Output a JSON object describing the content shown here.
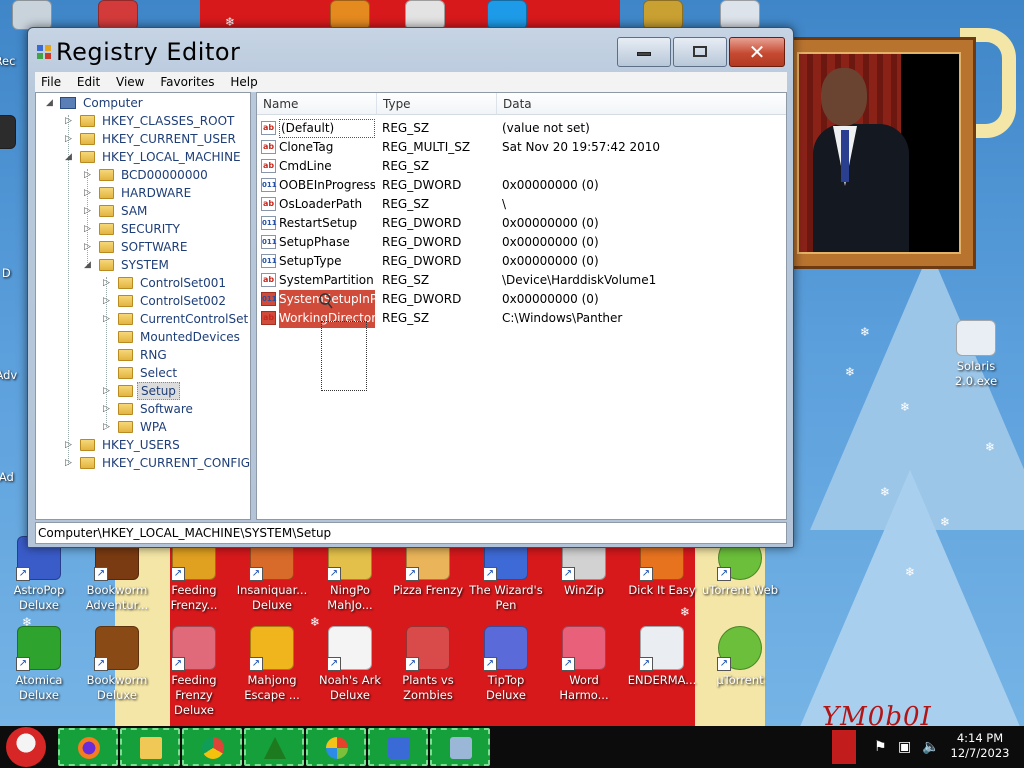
{
  "window": {
    "title": "Registry Editor",
    "menu": [
      "File",
      "Edit",
      "View",
      "Favorites",
      "Help"
    ],
    "status_path": "Computer\\HKEY_LOCAL_MACHINE\\SYSTEM\\Setup"
  },
  "tree": {
    "root": "Computer",
    "hives": [
      "HKEY_CLASSES_ROOT",
      "HKEY_CURRENT_USER",
      "HKEY_LOCAL_MACHINE",
      "HKEY_USERS",
      "HKEY_CURRENT_CONFIG"
    ],
    "hklm_children": [
      "BCD00000000",
      "HARDWARE",
      "SAM",
      "SECURITY",
      "SOFTWARE",
      "SYSTEM"
    ],
    "system_children": [
      "ControlSet001",
      "ControlSet002",
      "CurrentControlSet",
      "MountedDevices",
      "RNG",
      "Select",
      "Setup",
      "Software",
      "WPA"
    ],
    "selected": "Setup"
  },
  "list": {
    "columns": [
      "Name",
      "Type",
      "Data"
    ],
    "rows": [
      {
        "name": "(Default)",
        "type": "REG_SZ",
        "data": "(value not set)",
        "icon": "string-value-icon"
      },
      {
        "name": "CloneTag",
        "type": "REG_MULTI_SZ",
        "data": "Sat Nov 20 19:57:42 2010",
        "icon": "string-value-icon"
      },
      {
        "name": "CmdLine",
        "type": "REG_SZ",
        "data": "",
        "icon": "string-value-icon"
      },
      {
        "name": "OOBEInProgress",
        "type": "REG_DWORD",
        "data": "0x00000000 (0)",
        "icon": "binary-value-icon"
      },
      {
        "name": "OsLoaderPath",
        "type": "REG_SZ",
        "data": "\\",
        "icon": "string-value-icon"
      },
      {
        "name": "RestartSetup",
        "type": "REG_DWORD",
        "data": "0x00000000 (0)",
        "icon": "binary-value-icon"
      },
      {
        "name": "SetupPhase",
        "type": "REG_DWORD",
        "data": "0x00000000 (0)",
        "icon": "binary-value-icon"
      },
      {
        "name": "SetupType",
        "type": "REG_DWORD",
        "data": "0x00000000 (0)",
        "icon": "binary-value-icon"
      },
      {
        "name": "SystemPartition",
        "type": "REG_SZ",
        "data": "\\Device\\HarddiskVolume1",
        "icon": "string-value-icon"
      },
      {
        "name": "SystemSetupInP...",
        "type": "REG_DWORD",
        "data": "0x00000000 (0)",
        "icon": "binary-value-icon"
      },
      {
        "name": "WorkingDirectory",
        "type": "REG_SZ",
        "data": "C:\\Windows\\Panther",
        "icon": "string-value-icon"
      }
    ]
  },
  "desktop": {
    "icons_row1": [
      "AstroPop Deluxe",
      "Bookworm Adventur...",
      "Feeding Frenzy...",
      "Insaniquar... Deluxe",
      "NingPo MahJo...",
      "Pizza Frenzy",
      "The Wizard's Pen",
      "WinZip",
      "Dick It Easy",
      "uTorrent Web"
    ],
    "icons_row2": [
      "Atomica Deluxe",
      "Bookworm Deluxe",
      "Feeding Frenzy Deluxe",
      "Mahjong Escape ...",
      "Noah's Ark Deluxe",
      "Plants vs Zombies",
      "TipTop Deluxe",
      "Word Harmo...",
      "ENDERMA...",
      "µTorrent"
    ],
    "right_icon": "Solaris 2.0.exe",
    "left_partial": [
      "Rec",
      "Al D",
      "Al Adv",
      "Al Ad"
    ],
    "watermark": "YM0b0I"
  },
  "taskbar": {
    "time": "4:14 PM",
    "date": "12/7/2023"
  },
  "colors": {
    "selection_red": "#d14b3a",
    "taskbar_green": "#16a03c",
    "desktop_blue": "#4b8fd0"
  }
}
